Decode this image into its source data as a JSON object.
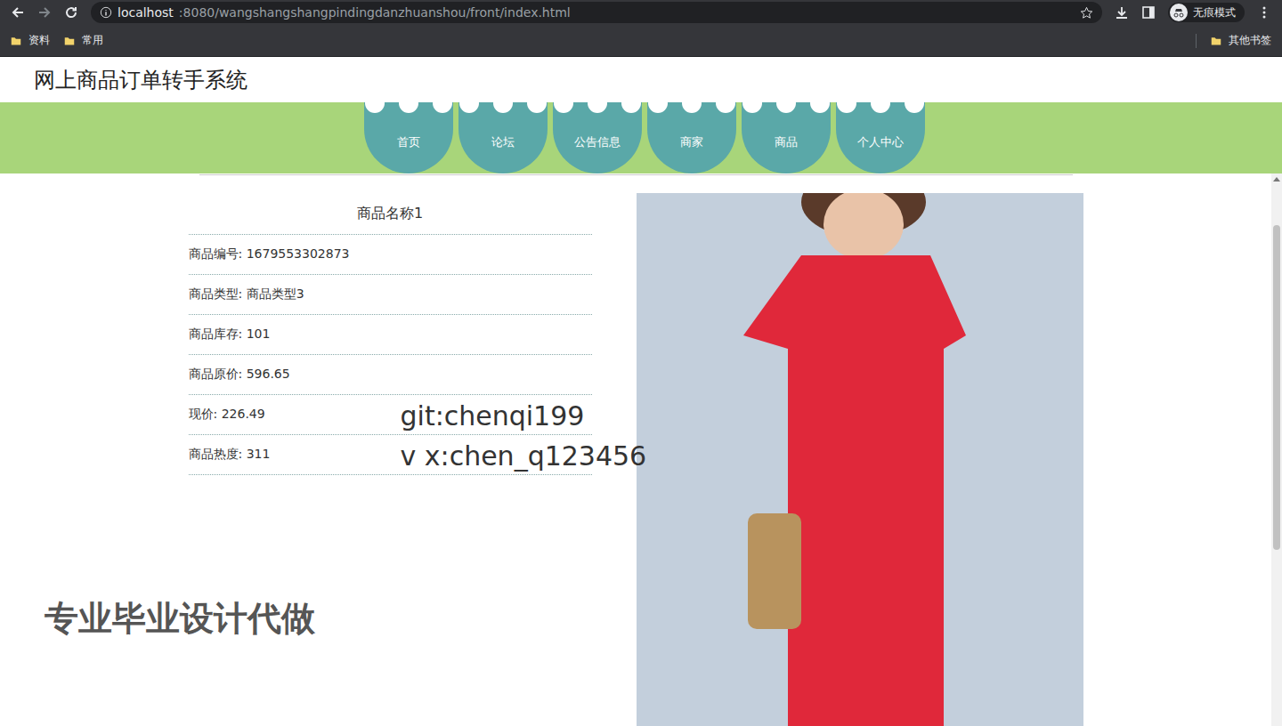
{
  "browser": {
    "url_host": "localhost",
    "url_rest": ":8080/wangshangshangpindingdanzhuanshou/front/index.html",
    "incognito_label": "无痕模式",
    "bookmarks": [
      "资料",
      "常用"
    ],
    "other_bookmarks": "其他书签"
  },
  "site": {
    "title": "网上商品订单转手系统"
  },
  "nav": [
    {
      "label": "首页",
      "selected": false
    },
    {
      "label": "论坛",
      "selected": false
    },
    {
      "label": "公告信息",
      "selected": false
    },
    {
      "label": "商家",
      "selected": false
    },
    {
      "label": "商品",
      "selected": false
    },
    {
      "label": "个人中心",
      "selected": false
    }
  ],
  "product": {
    "name": "商品名称1",
    "fields": [
      {
        "label": "商品编号:",
        "value": "1679553302873"
      },
      {
        "label": "商品类型:",
        "value": "商品类型3"
      },
      {
        "label": "商品库存:",
        "value": "101"
      },
      {
        "label": "商品原价:",
        "value": "596.65"
      },
      {
        "label": "现价:",
        "value": "226.49"
      },
      {
        "label": "商品热度:",
        "value": "311"
      }
    ]
  },
  "overlays": {
    "git": "git:chenqi199",
    "wx": "v x:chen_q123456",
    "ad": "专业毕业设计代做"
  }
}
